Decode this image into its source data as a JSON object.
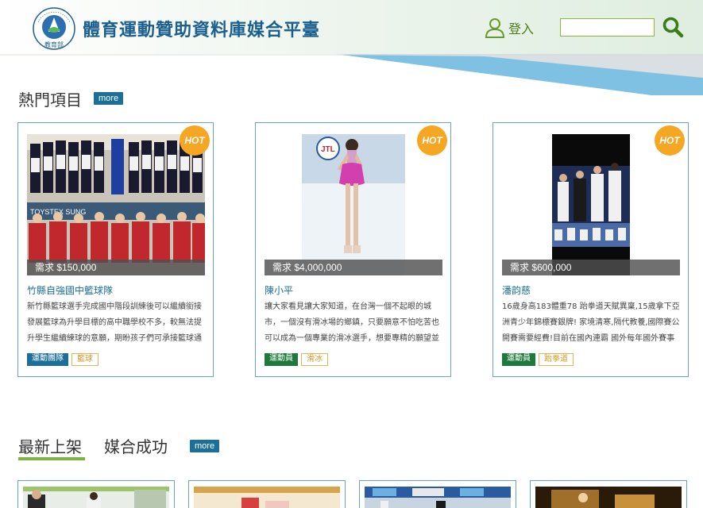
{
  "header": {
    "logo_text": "MINISTRY OF EDUCATION",
    "logo_cn": "教育部",
    "title": "體育運動贊助資料庫媒合平臺",
    "login_label": "登入",
    "search_placeholder": ""
  },
  "colors": {
    "brand_blue": "#1b5f8f",
    "accent_green": "#7cb342",
    "hot_orange": "#f5a623",
    "tag_blue": "#1b6f98",
    "tag_green": "#1e7a3c"
  },
  "hot_section": {
    "title": "熱門項目",
    "more_label": "more",
    "cards": [
      {
        "hot": "HOT",
        "amount": "需求 $150,000",
        "title": "竹縣自強國中籃球隊",
        "desc": "新竹縣籃球選手完成國中階段訓練後可以繼續銜接發展籃球為升學目標的高中職學校不多，較無法提升學生繼續練球的意願，期盼孩子們可承接籃球通",
        "tag_primary": "運動團隊",
        "tag_primary_color": "#1b6f98",
        "tag_secondary": "籃球"
      },
      {
        "hot": "HOT",
        "amount": "需求 $4,000,000",
        "title": "陳小平",
        "desc": "讓大家看見讓大家知道，在台灣一個不起眼的城市，一個沒有滑冰場的鄉鎮，只要願意不怕吃苦也可以成為一個專業的滑冰選手，想要專精的願望並",
        "tag_primary": "運動員",
        "tag_primary_color": "#1e7a3c",
        "tag_secondary": "滑冰"
      },
      {
        "hot": "HOT",
        "amount": "需求 $600,000",
        "title": "潘韵慈",
        "desc": "16歲身高183體重78 跆拳道天賦異稟,15歲拿下亞洲青少年錦標賽銀牌! 家境清寒,隔代教養,國際賽公開賽需要經費!目前在國內連霸 國外每年國外賽事都有",
        "tag_primary": "運動員",
        "tag_primary_color": "#1e7a3c",
        "tag_secondary": "跆拳道"
      }
    ]
  },
  "latest_section": {
    "tab_active": "最新上架",
    "tab_other": "媒合成功",
    "more_label": "more"
  }
}
